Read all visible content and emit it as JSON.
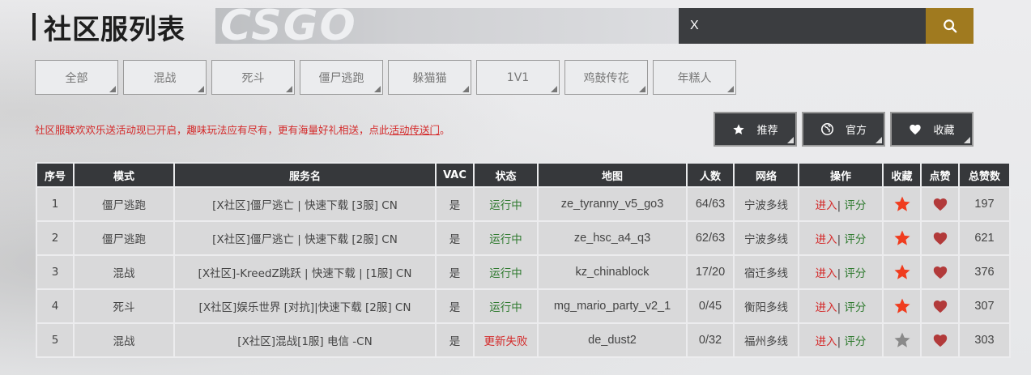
{
  "header": {
    "title": "社区服列表",
    "banner_logo": "CSGO",
    "search_value": "X"
  },
  "tabs": [
    {
      "label": "全部"
    },
    {
      "label": "混战"
    },
    {
      "label": "死斗"
    },
    {
      "label": "僵尸逃跑"
    },
    {
      "label": "躲猫猫"
    },
    {
      "label": "1V1"
    },
    {
      "label": "鸡鼓传花"
    },
    {
      "label": "年糕人"
    }
  ],
  "notice": {
    "text": "社区服联欢欢乐送活动现已开启，趣味玩法应有尽有，更有海量好礼相送，点此",
    "link": "活动传送门",
    "end": "。"
  },
  "actions": {
    "recommend": "推荐",
    "official": "官方",
    "favorite": "收藏"
  },
  "table": {
    "headers": [
      "序号",
      "模式",
      "服务名",
      "VAC",
      "状态",
      "地图",
      "人数",
      "网络",
      "操作",
      "收藏",
      "点赞",
      "总赞数"
    ],
    "op_enter": "进入",
    "op_sep": "|",
    "op_rate": "评分",
    "rows": [
      {
        "idx": "1",
        "mode": "僵尸逃跑",
        "name": "[X社区]僵尸逃亡 | 快速下载 [3服] CN",
        "vac": "是",
        "status": "运行中",
        "status_type": "run",
        "map": "ze_tyranny_v5_go3",
        "players": "64/63",
        "network": "宁波多线",
        "fav": true,
        "likes": "197"
      },
      {
        "idx": "2",
        "mode": "僵尸逃跑",
        "name": "[X社区]僵尸逃亡 | 快速下载 [2服] CN",
        "vac": "是",
        "status": "运行中",
        "status_type": "run",
        "map": "ze_hsc_a4_q3",
        "players": "62/63",
        "network": "宁波多线",
        "fav": true,
        "likes": "621"
      },
      {
        "idx": "3",
        "mode": "混战",
        "name": "[X社区]-KreedZ跳跃 | 快速下载 | [1服] CN",
        "vac": "是",
        "status": "运行中",
        "status_type": "run",
        "map": "kz_chinablock",
        "players": "17/20",
        "network": "宿迁多线",
        "fav": true,
        "likes": "376"
      },
      {
        "idx": "4",
        "mode": "死斗",
        "name": "[X社区]娱乐世界 [对抗]|快速下载 [2服] CN",
        "vac": "是",
        "status": "运行中",
        "status_type": "run",
        "map": "mg_mario_party_v2_1",
        "players": "0/45",
        "network": "衡阳多线",
        "fav": true,
        "likes": "307"
      },
      {
        "idx": "5",
        "mode": "混战",
        "name": "[X社区]混战[1服] 电信 -CN",
        "vac": "是",
        "status": "更新失败",
        "status_type": "fail",
        "map": "de_dust2",
        "players": "0/32",
        "network": "福州多线",
        "fav": false,
        "likes": "303"
      }
    ]
  },
  "colors": {
    "accent": "#a07a1f",
    "dark": "#36383b",
    "star_active": "#f03c1e",
    "star_inactive": "#8a8a8a",
    "heart": "#b23a3a",
    "running": "#2f7a2f",
    "failed": "#d42a2a"
  },
  "icons": {
    "search": "search-icon",
    "recommend": "star-icon",
    "official": "globe-icon",
    "favorite": "heart-icon"
  }
}
